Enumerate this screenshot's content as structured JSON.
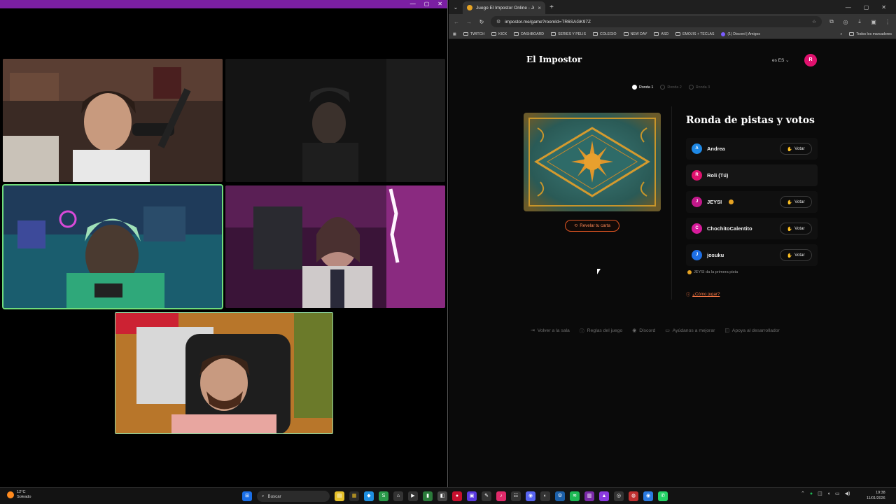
{
  "call": {
    "titlebar_buttons": [
      "—",
      "▢",
      "✕"
    ]
  },
  "browser": {
    "tab_title": "Juego El Impostor Online - Jug",
    "url": "impostor.me/game?roomId=TR6SAGK97Z",
    "window_controls": [
      "—",
      "▢",
      "✕"
    ],
    "bookmarks": [
      "TWITCH",
      "KICK",
      "DASHBOARD",
      "SERIES Y PELIS",
      "COLEGIO",
      "NEW DAY",
      "ASD",
      "EMOJIS + TECLAS",
      "(1) Discord | Amigos"
    ],
    "bookmarks_all": "Todos los marcadores"
  },
  "page": {
    "brand": "El Impostor",
    "lang": "es ES",
    "user_initial": "R",
    "rounds": [
      "Ronda 1",
      "Ronda 2",
      "Ronda 3"
    ],
    "reveal_label": "Revelar tu carta",
    "panel_title": "Ronda de pistas y votos",
    "vote_label": "Votar",
    "players": [
      {
        "initial": "A",
        "name": "Andrea",
        "color": "#1e88e5",
        "can_vote": true,
        "badge": false
      },
      {
        "initial": "R",
        "name": "Roli (Tú)",
        "color": "#e0116e",
        "can_vote": false,
        "badge": false
      },
      {
        "initial": "J",
        "name": "JEYSI",
        "color": "#c2188a",
        "can_vote": true,
        "badge": true
      },
      {
        "initial": "C",
        "name": "ChochitoCalentito",
        "color": "#d81b9c",
        "can_vote": true,
        "badge": false
      },
      {
        "initial": "J",
        "name": "josuku",
        "color": "#1e6fe5",
        "can_vote": true,
        "badge": false
      }
    ],
    "hint": "JEYSI da la primera pista",
    "howto": "¿Cómo jugar?",
    "footer": [
      "Volver a la sala",
      "Reglas del juego",
      "Discord",
      "Ayúdanos a mejorar",
      "Apoya al desarrollador"
    ]
  },
  "taskbar": {
    "temp": "12°C",
    "weather": "Soleado",
    "search_placeholder": "Buscar",
    "time": "19:38",
    "date": "11/01/2026"
  }
}
